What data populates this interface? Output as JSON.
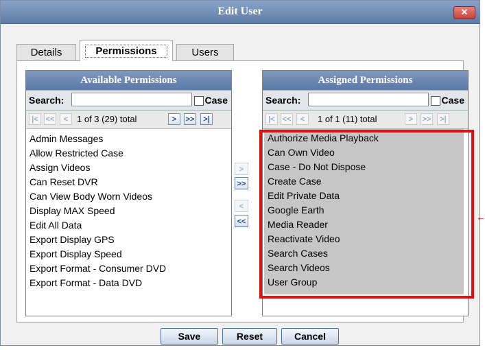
{
  "dialog": {
    "title": "Edit User",
    "close_label": "✕"
  },
  "tabs": [
    {
      "label": "Details"
    },
    {
      "label": "Permissions"
    },
    {
      "label": "Users"
    }
  ],
  "available": {
    "header": "Available Permissions",
    "search_label": "Search:",
    "search_value": "",
    "case_label": "Case",
    "pager_text": "1 of 3 (29) total",
    "items": [
      "Admin Messages",
      "Allow Restricted Case",
      "Assign Videos",
      "Can Reset DVR",
      "Can View Body Worn Videos",
      "Display MAX Speed",
      "Edit All Data",
      "Export Display GPS",
      "Export Display Speed",
      "Export Format - Consumer DVD",
      "Export Format - Data DVD"
    ]
  },
  "assigned": {
    "header": "Assigned Permissions",
    "search_label": "Search:",
    "search_value": "",
    "case_label": "Case",
    "pager_text": "1 of 1 (11) total",
    "items": [
      "Authorize Media Playback",
      "Can Own Video",
      "Case - Do Not Dispose",
      "Create Case",
      "Edit Private Data",
      "Google Earth",
      "Media Reader",
      "Reactivate Video",
      "Search Cases",
      "Search Videos",
      "User Group"
    ]
  },
  "pager_icons": {
    "first": "|<",
    "prev_page": "<<",
    "prev": "<",
    "next": ">",
    "next_page": ">>",
    "last": ">|"
  },
  "transfer_icons": {
    "add": ">",
    "add_all": ">>",
    "remove": "<",
    "remove_all": "<<"
  },
  "buttons": {
    "save": "Save",
    "reset": "Reset",
    "cancel": "Cancel"
  },
  "colors": {
    "highlight_border": "#e01010",
    "header_blue": "#5a79a7"
  }
}
